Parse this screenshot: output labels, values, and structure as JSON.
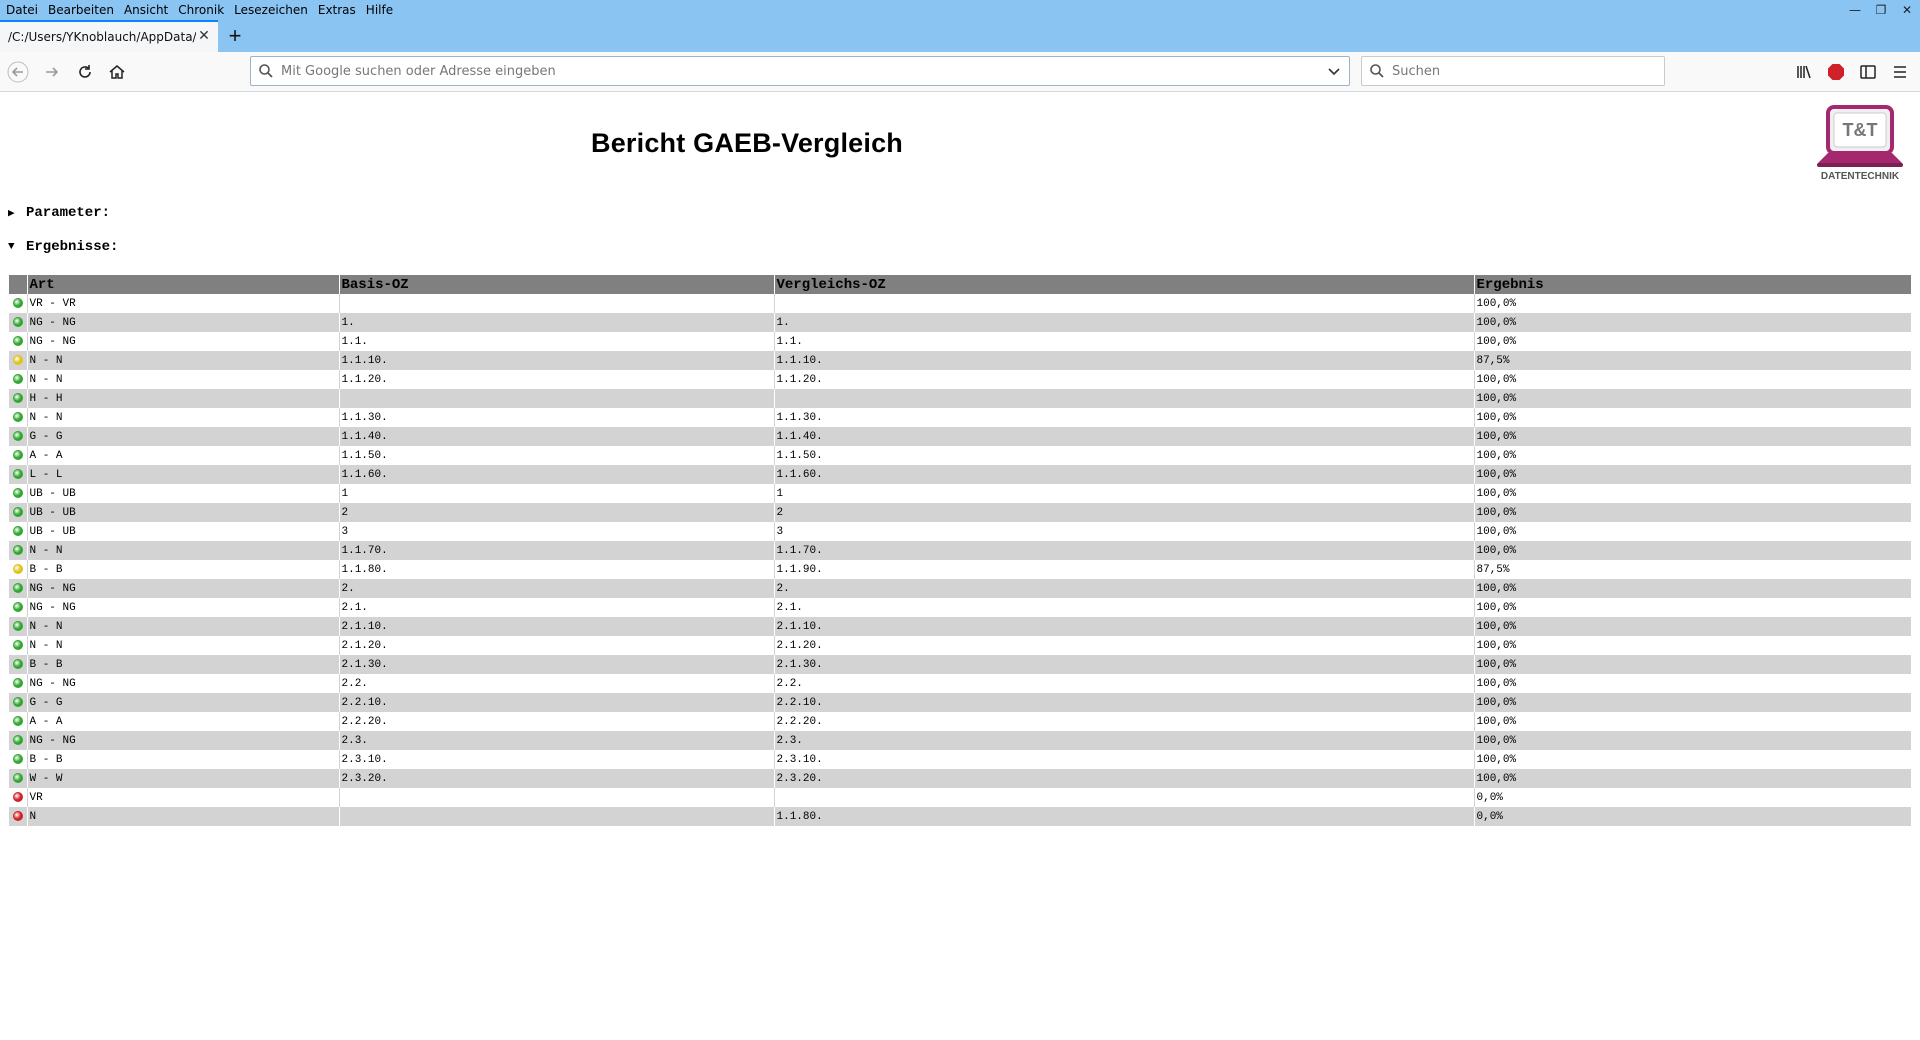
{
  "browser": {
    "menu": [
      "Datei",
      "Bearbeiten",
      "Ansicht",
      "Chronik",
      "Lesezeichen",
      "Extras",
      "Hilfe"
    ],
    "tab_title": "/C:/Users/YKnoblauch/AppData/Lo",
    "url_placeholder": "Mit Google suchen oder Adresse eingeben",
    "search_placeholder": "Suchen",
    "abp_label": "ABP"
  },
  "report": {
    "title": "Bericht GAEB-Vergleich",
    "logo_text": "T&T",
    "logo_subtext": "DATENTECHNIK",
    "section_params": "Parameter:",
    "section_results": "Ergebnisse:",
    "columns": [
      "Art",
      "Basis-OZ",
      "Vergleichs-OZ",
      "Ergebnis"
    ],
    "status_colors": {
      "green": "#2fa82f",
      "yellow": "#e0c21a",
      "red": "#d0202a"
    },
    "rows": [
      {
        "status": "green",
        "art": "VR - VR",
        "basis": "",
        "vergleich": "",
        "ergebnis": "100,0%"
      },
      {
        "status": "green",
        "art": "NG - NG",
        "basis": "1.",
        "vergleich": "1.",
        "ergebnis": "100,0%"
      },
      {
        "status": "green",
        "art": "NG - NG",
        "basis": "1.1.",
        "vergleich": "1.1.",
        "ergebnis": "100,0%"
      },
      {
        "status": "yellow",
        "art": "N - N",
        "basis": "1.1.10.",
        "vergleich": "1.1.10.",
        "ergebnis": "87,5%"
      },
      {
        "status": "green",
        "art": "N - N",
        "basis": "1.1.20.",
        "vergleich": "1.1.20.",
        "ergebnis": "100,0%"
      },
      {
        "status": "green",
        "art": "H - H",
        "basis": "",
        "vergleich": "",
        "ergebnis": "100,0%"
      },
      {
        "status": "green",
        "art": "N - N",
        "basis": "1.1.30.",
        "vergleich": "1.1.30.",
        "ergebnis": "100,0%"
      },
      {
        "status": "green",
        "art": "G - G",
        "basis": "1.1.40.",
        "vergleich": "1.1.40.",
        "ergebnis": "100,0%"
      },
      {
        "status": "green",
        "art": "A - A",
        "basis": "1.1.50.",
        "vergleich": "1.1.50.",
        "ergebnis": "100,0%"
      },
      {
        "status": "green",
        "art": "L - L",
        "basis": "1.1.60.",
        "vergleich": "1.1.60.",
        "ergebnis": "100,0%"
      },
      {
        "status": "green",
        "art": "UB - UB",
        "basis": "1",
        "vergleich": "1",
        "ergebnis": "100,0%"
      },
      {
        "status": "green",
        "art": "UB - UB",
        "basis": "2",
        "vergleich": "2",
        "ergebnis": "100,0%"
      },
      {
        "status": "green",
        "art": "UB - UB",
        "basis": "3",
        "vergleich": "3",
        "ergebnis": "100,0%"
      },
      {
        "status": "green",
        "art": "N - N",
        "basis": "1.1.70.",
        "vergleich": "1.1.70.",
        "ergebnis": "100,0%"
      },
      {
        "status": "yellow",
        "art": "B - B",
        "basis": "1.1.80.",
        "vergleich": "1.1.90.",
        "ergebnis": "87,5%"
      },
      {
        "status": "green",
        "art": "NG - NG",
        "basis": "2.",
        "vergleich": "2.",
        "ergebnis": "100,0%"
      },
      {
        "status": "green",
        "art": "NG - NG",
        "basis": "2.1.",
        "vergleich": "2.1.",
        "ergebnis": "100,0%"
      },
      {
        "status": "green",
        "art": "N - N",
        "basis": "2.1.10.",
        "vergleich": "2.1.10.",
        "ergebnis": "100,0%"
      },
      {
        "status": "green",
        "art": "N - N",
        "basis": "2.1.20.",
        "vergleich": "2.1.20.",
        "ergebnis": "100,0%"
      },
      {
        "status": "green",
        "art": "B - B",
        "basis": "2.1.30.",
        "vergleich": "2.1.30.",
        "ergebnis": "100,0%"
      },
      {
        "status": "green",
        "art": "NG - NG",
        "basis": "2.2.",
        "vergleich": "2.2.",
        "ergebnis": "100,0%"
      },
      {
        "status": "green",
        "art": "G - G",
        "basis": "2.2.10.",
        "vergleich": "2.2.10.",
        "ergebnis": "100,0%"
      },
      {
        "status": "green",
        "art": "A - A",
        "basis": "2.2.20.",
        "vergleich": "2.2.20.",
        "ergebnis": "100,0%"
      },
      {
        "status": "green",
        "art": "NG - NG",
        "basis": "2.3.",
        "vergleich": "2.3.",
        "ergebnis": "100,0%"
      },
      {
        "status": "green",
        "art": "B - B",
        "basis": "2.3.10.",
        "vergleich": "2.3.10.",
        "ergebnis": "100,0%"
      },
      {
        "status": "green",
        "art": "W - W",
        "basis": "2.3.20.",
        "vergleich": "2.3.20.",
        "ergebnis": "100,0%"
      },
      {
        "status": "red",
        "art": "VR",
        "basis": "",
        "vergleich": "",
        "ergebnis": "0,0%"
      },
      {
        "status": "red",
        "art": "N",
        "basis": "",
        "vergleich": "1.1.80.",
        "ergebnis": "0,0%"
      }
    ]
  }
}
